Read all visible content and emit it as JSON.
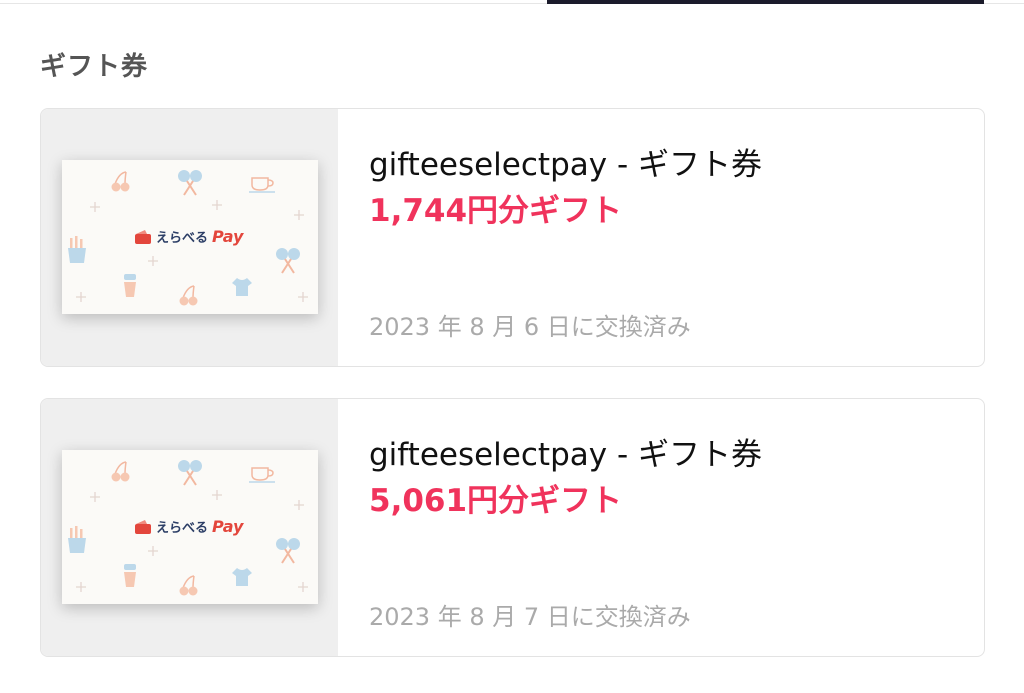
{
  "section": {
    "title": "ギフト券"
  },
  "cards": [
    {
      "title": "gifteeselectpay - ギフト券",
      "amount": "1,744円分ギフト",
      "date": "2023 年 8 月 6 日に交換済み",
      "logo_text_jp": "えらべる",
      "logo_text_en": "Pay"
    },
    {
      "title": "gifteeselectpay - ギフト券",
      "amount": "5,061円分ギフト",
      "date": "2023 年 8 月 7 日に交換済み",
      "logo_text_jp": "えらべる",
      "logo_text_en": "Pay"
    }
  ],
  "colors": {
    "amount": "#f0335c",
    "tab_indicator": "#1b1b2b",
    "logo_red": "#e3463c",
    "logo_navy": "#2c3e66"
  },
  "icons": [
    "cherry-icon",
    "maracas-icon",
    "coffee-cup-icon",
    "fries-icon",
    "drink-cup-icon",
    "tshirt-icon",
    "sparkle-icon",
    "wallet-icon"
  ]
}
